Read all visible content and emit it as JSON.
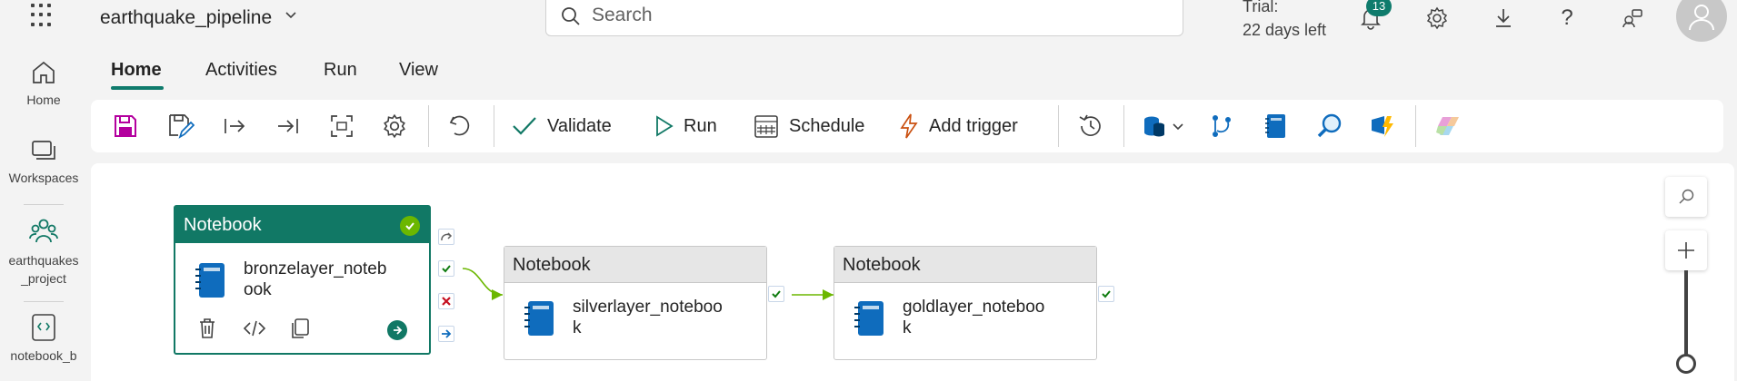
{
  "topbar": {
    "pipeline_name": "earthquake_pipeline",
    "search_placeholder": "Search",
    "trial_line1": "Trial:",
    "trial_line2": "22 days left",
    "notification_count": "13"
  },
  "leftnav": {
    "items": [
      {
        "label": "Home",
        "icon": "home-icon"
      },
      {
        "label": "Workspaces",
        "icon": "workspaces-icon"
      },
      {
        "label": "earthquakes\n_project",
        "label_line1": "earthquakes",
        "label_line2": "_project",
        "icon": "project-icon"
      },
      {
        "label": "notebook_b",
        "icon": "notebook-icon"
      }
    ]
  },
  "tabs": [
    {
      "label": "Home",
      "active": true
    },
    {
      "label": "Activities"
    },
    {
      "label": "Run"
    },
    {
      "label": "View"
    }
  ],
  "ribbon": {
    "validate": "Validate",
    "run": "Run",
    "schedule": "Schedule",
    "add_trigger": "Add trigger"
  },
  "canvas": {
    "activities": [
      {
        "type": "Notebook",
        "name": "bronzelayer_notebook",
        "line1": "bronzelayer_noteb",
        "line2": "ook",
        "selected": true,
        "status": "succeeded"
      },
      {
        "type": "Notebook",
        "name": "silverlayer_notebook",
        "line1": "silverlayer_noteboo",
        "line2": "k"
      },
      {
        "type": "Notebook",
        "name": "goldlayer_notebook",
        "line1": "goldlayer_noteboo",
        "line2": "k"
      }
    ]
  },
  "colors": {
    "accent": "#117865",
    "success": "#6bb700",
    "fail": "#c50f1f",
    "link": "#0f6cbd"
  }
}
